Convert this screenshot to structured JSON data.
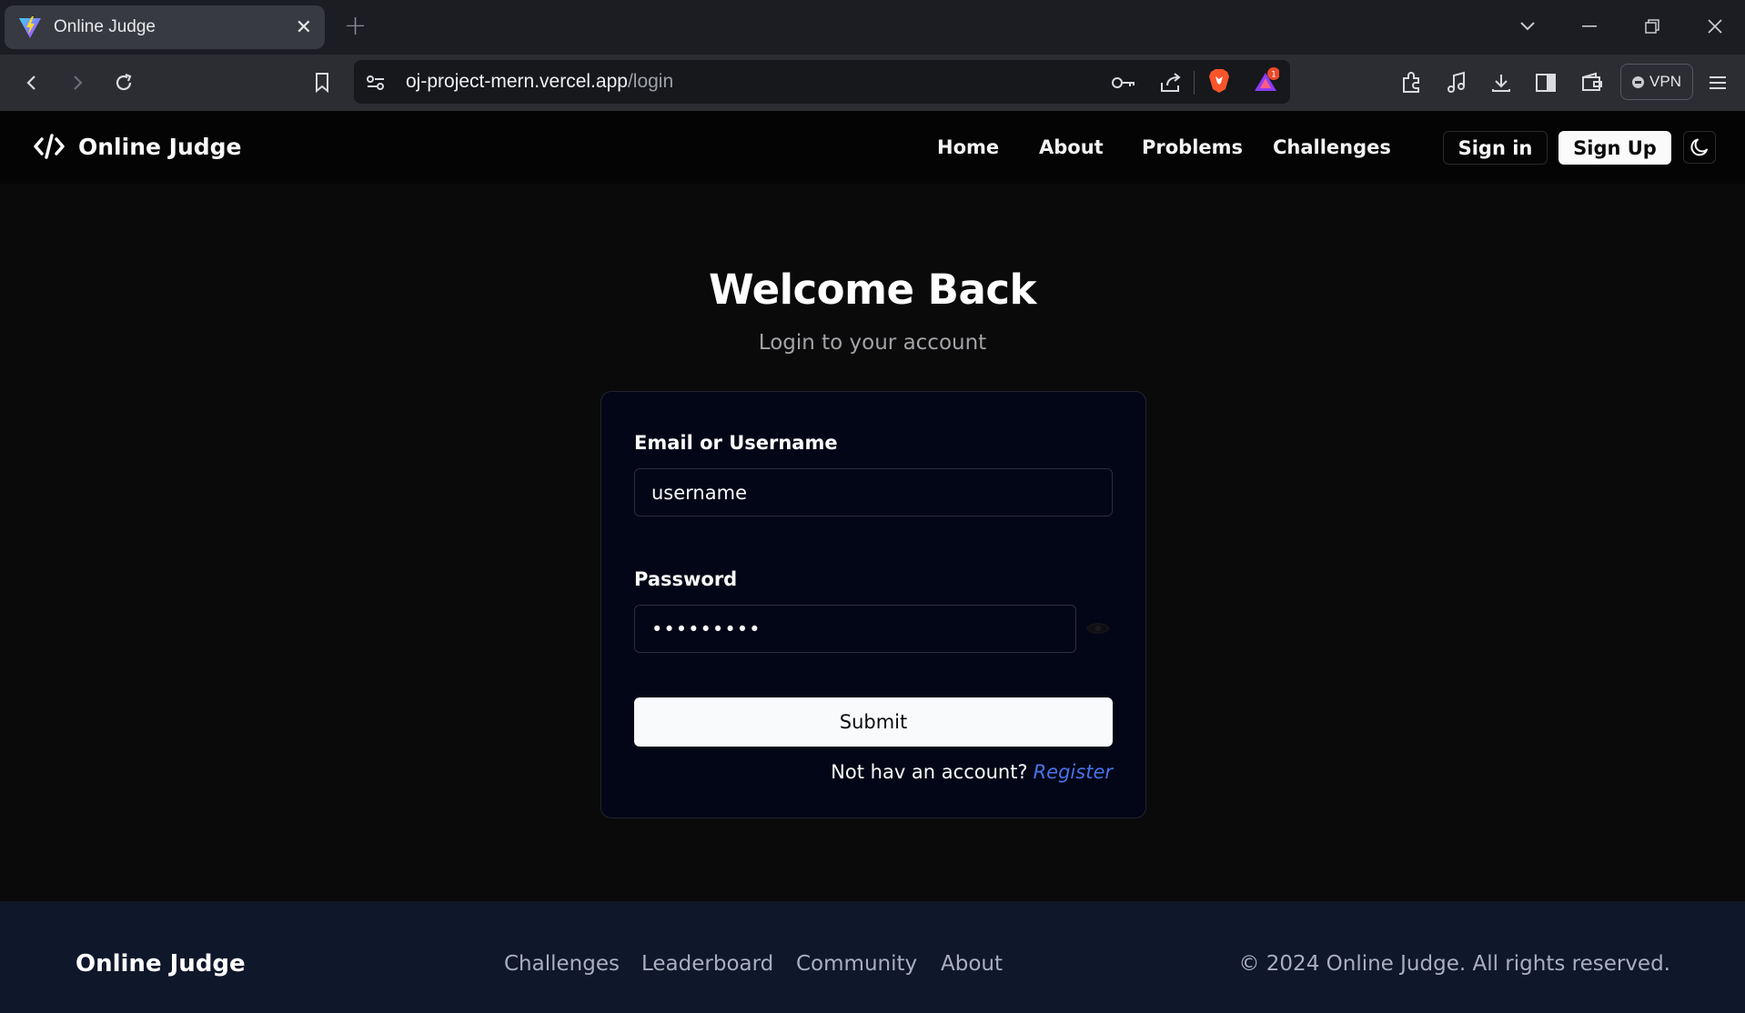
{
  "browser": {
    "tab_title": "Online Judge",
    "url_host": "oj-project-mern.vercel.app",
    "url_path": "/login",
    "vpn_label": "VPN",
    "notification_count": "1"
  },
  "nav": {
    "brand": "Online Judge",
    "links": [
      "Home",
      "About",
      "Problems",
      "Challenges"
    ],
    "sign_in": "Sign in",
    "sign_up": "Sign Up"
  },
  "login": {
    "title": "Welcome Back",
    "subtitle": "Login to your account",
    "email_label": "Email or Username",
    "email_value": "username",
    "password_label": "Password",
    "password_value": "•••••••••",
    "submit_label": "Submit",
    "register_prompt": "Not hav an account?",
    "register_link": "Register"
  },
  "footer": {
    "brand": "Online Judge",
    "links": [
      "Challenges",
      "Leaderboard",
      "Community",
      "About"
    ],
    "copyright": "© 2024 Online Judge. All rights reserved."
  },
  "colors": {
    "page_bg": "#0a0a0a",
    "card_bg": "#020617",
    "footer_bg": "#0f172a",
    "link_accent": "#4a72e8"
  }
}
